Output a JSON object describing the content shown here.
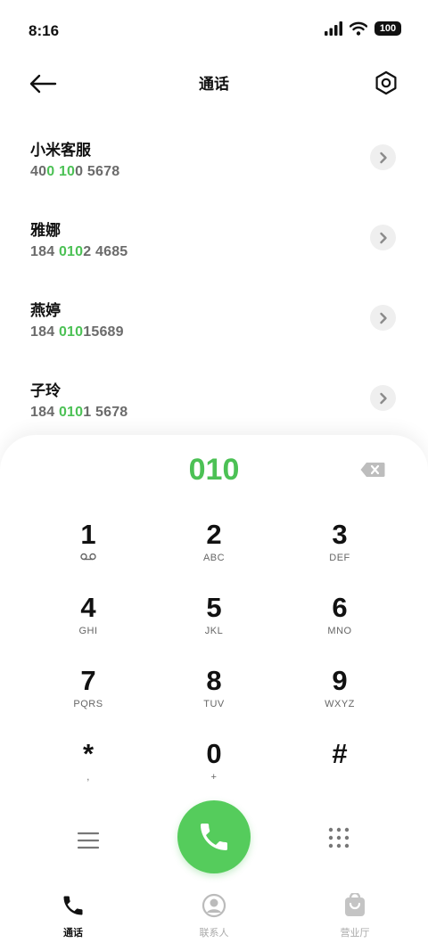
{
  "status": {
    "time": "8:16",
    "battery": "100"
  },
  "header": {
    "title": "通话"
  },
  "contacts": [
    {
      "name": "小米客服",
      "num_parts": [
        "40",
        "0 10",
        "0 5678"
      ]
    },
    {
      "name": "雅娜",
      "num_parts": [
        "184 ",
        "010",
        "2 4685"
      ]
    },
    {
      "name": "燕婷",
      "num_parts": [
        "184 ",
        "010",
        "15689"
      ]
    },
    {
      "name": "子玲",
      "num_parts": [
        "184 ",
        "010",
        "1 5678"
      ]
    }
  ],
  "dialer": {
    "input": "010",
    "keys": [
      {
        "digit": "1",
        "letters": ""
      },
      {
        "digit": "2",
        "letters": "ABC"
      },
      {
        "digit": "3",
        "letters": "DEF"
      },
      {
        "digit": "4",
        "letters": "GHI"
      },
      {
        "digit": "5",
        "letters": "JKL"
      },
      {
        "digit": "6",
        "letters": "MNO"
      },
      {
        "digit": "7",
        "letters": "PQRS"
      },
      {
        "digit": "8",
        "letters": "TUV"
      },
      {
        "digit": "9",
        "letters": "WXYZ"
      },
      {
        "digit": "*",
        "letters": ","
      },
      {
        "digit": "0",
        "letters": "+"
      },
      {
        "digit": "#",
        "letters": ""
      }
    ]
  },
  "tabs": [
    {
      "label": "通话",
      "icon": "phone-icon",
      "active": true
    },
    {
      "label": "联系人",
      "icon": "contacts-icon",
      "active": false
    },
    {
      "label": "营业厅",
      "icon": "service-hall-icon",
      "active": false
    }
  ],
  "colors": {
    "accent": "#4cc155",
    "call": "#55cc5c"
  }
}
